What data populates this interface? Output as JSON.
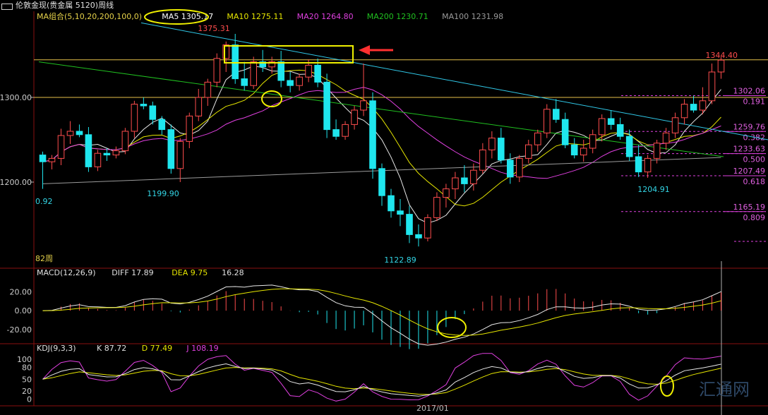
{
  "window": {
    "title": "伦敦金现(贵金属 5120)周线"
  },
  "colors": {
    "up": "#ff4d4d",
    "down": "#1fe6ee",
    "ma5": "#e8e8e8",
    "ma10": "#e6e600",
    "ma20": "#e040e0",
    "ma200": "#20c020",
    "ma100": "#9a9a9a",
    "hline": "#e6c14a",
    "trend": "#30c8e8",
    "annot_yellow": "#f0f000",
    "annot_red": "#ff3030",
    "grid": "#8a1010"
  },
  "price_panel": {
    "legend": [
      {
        "label": "MA组合(5,10,20,200,100,0)",
        "color": "#e6d24a"
      },
      {
        "label": "MA5 1305.17",
        "color": "#ffffff"
      },
      {
        "label": "MA10 1275.11",
        "color": "#e6e600"
      },
      {
        "label": "MA20 1264.80",
        "color": "#e040e0"
      },
      {
        "label": "MA200 1230.71",
        "color": "#20c020"
      },
      {
        "label": "MA100 1231.98",
        "color": "#9a9a9a"
      }
    ],
    "y_ticks": [
      "1300.00",
      "1200.00"
    ],
    "annotations": {
      "high": "1375.31",
      "low1": "1199.90",
      "low2": "1122.89",
      "low3": "1204.91",
      "last": "1344.40",
      "left_small": "0.92",
      "bars_label": "82周"
    },
    "fib_levels": [
      {
        "price": "1302.06",
        "ratio": "0.191"
      },
      {
        "price": "1259.76",
        "ratio": "0.382"
      },
      {
        "price": "1233.63",
        "ratio": "0.500"
      },
      {
        "price": "1207.49",
        "ratio": "0.618"
      },
      {
        "price": "1165.19",
        "ratio": "0.809"
      }
    ]
  },
  "macd_panel": {
    "legend": [
      {
        "label": "MACD(12,26,9)",
        "color": "#e0e0e0"
      },
      {
        "label": "DIFF 17.89",
        "color": "#e0e0e0"
      },
      {
        "label": "DEA 9.75",
        "color": "#e6e600"
      },
      {
        "label": "16.28",
        "color": "#e0e0e0"
      }
    ],
    "y_ticks": [
      "20.00",
      "0.00",
      "-20.00"
    ]
  },
  "kdj_panel": {
    "legend": [
      {
        "label": "KDJ(9,3,3)",
        "color": "#e0e0e0"
      },
      {
        "label": "K 87.72",
        "color": "#e0e0e0"
      },
      {
        "label": "D 77.49",
        "color": "#e6e600"
      },
      {
        "label": "J 108.19",
        "color": "#e040e0"
      }
    ],
    "y_ticks": [
      "100",
      "80",
      "50",
      "20",
      "0"
    ]
  },
  "x_axis": {
    "label": "2017/01"
  },
  "watermark": "汇通网",
  "chart_data": {
    "type": "candlestick",
    "timeframe": "weekly",
    "ylim": [
      1100,
      1390
    ],
    "candles": [
      [
        1232,
        1236,
        1192,
        1224
      ],
      [
        1224,
        1232,
        1215,
        1228
      ],
      [
        1228,
        1263,
        1220,
        1255
      ],
      [
        1255,
        1272,
        1245,
        1260
      ],
      [
        1260,
        1268,
        1253,
        1256
      ],
      [
        1256,
        1265,
        1212,
        1218
      ],
      [
        1218,
        1238,
        1213,
        1234
      ],
      [
        1234,
        1240,
        1225,
        1232
      ],
      [
        1232,
        1242,
        1228,
        1237
      ],
      [
        1237,
        1264,
        1233,
        1260
      ],
      [
        1260,
        1296,
        1252,
        1292
      ],
      [
        1292,
        1300,
        1286,
        1290
      ],
      [
        1290,
        1295,
        1268,
        1274
      ],
      [
        1274,
        1278,
        1256,
        1262
      ],
      [
        1262,
        1268,
        1210,
        1216
      ],
      [
        1216,
        1252,
        1200,
        1248
      ],
      [
        1248,
        1282,
        1240,
        1278
      ],
      [
        1278,
        1310,
        1272,
        1300
      ],
      [
        1300,
        1322,
        1290,
        1318
      ],
      [
        1318,
        1352,
        1312,
        1346
      ],
      [
        1346,
        1366,
        1330,
        1362
      ],
      [
        1362,
        1375,
        1316,
        1322
      ],
      [
        1322,
        1342,
        1308,
        1314
      ],
      [
        1314,
        1348,
        1310,
        1342
      ],
      [
        1342,
        1356,
        1330,
        1336
      ],
      [
        1336,
        1348,
        1328,
        1342
      ],
      [
        1342,
        1355,
        1312,
        1320
      ],
      [
        1320,
        1330,
        1306,
        1314
      ],
      [
        1314,
        1328,
        1308,
        1324
      ],
      [
        1324,
        1345,
        1318,
        1338
      ],
      [
        1338,
        1346,
        1312,
        1318
      ],
      [
        1318,
        1328,
        1252,
        1262
      ],
      [
        1262,
        1274,
        1250,
        1254
      ],
      [
        1254,
        1272,
        1250,
        1268
      ],
      [
        1268,
        1290,
        1262,
        1285
      ],
      [
        1285,
        1340,
        1278,
        1296
      ],
      [
        1296,
        1306,
        1204,
        1216
      ],
      [
        1216,
        1222,
        1172,
        1184
      ],
      [
        1184,
        1192,
        1158,
        1166
      ],
      [
        1166,
        1180,
        1148,
        1162
      ],
      [
        1162,
        1172,
        1128,
        1138
      ],
      [
        1138,
        1150,
        1124,
        1134
      ],
      [
        1134,
        1162,
        1130,
        1158
      ],
      [
        1158,
        1188,
        1154,
        1182
      ],
      [
        1182,
        1198,
        1170,
        1192
      ],
      [
        1192,
        1212,
        1180,
        1205
      ],
      [
        1205,
        1220,
        1188,
        1198
      ],
      [
        1198,
        1222,
        1190,
        1214
      ],
      [
        1214,
        1246,
        1210,
        1238
      ],
      [
        1238,
        1260,
        1228,
        1252
      ],
      [
        1252,
        1264,
        1222,
        1226
      ],
      [
        1226,
        1234,
        1198,
        1206
      ],
      [
        1206,
        1232,
        1200,
        1228
      ],
      [
        1228,
        1250,
        1222,
        1244
      ],
      [
        1244,
        1262,
        1236,
        1258
      ],
      [
        1258,
        1292,
        1252,
        1286
      ],
      [
        1286,
        1298,
        1270,
        1274
      ],
      [
        1274,
        1282,
        1240,
        1244
      ],
      [
        1244,
        1252,
        1228,
        1232
      ],
      [
        1232,
        1250,
        1224,
        1240
      ],
      [
        1240,
        1262,
        1234,
        1256
      ],
      [
        1256,
        1280,
        1248,
        1275
      ],
      [
        1275,
        1285,
        1262,
        1268
      ],
      [
        1268,
        1276,
        1250,
        1254
      ],
      [
        1254,
        1262,
        1225,
        1230
      ],
      [
        1230,
        1244,
        1206,
        1212
      ],
      [
        1212,
        1232,
        1205,
        1228
      ],
      [
        1228,
        1250,
        1222,
        1246
      ],
      [
        1246,
        1264,
        1238,
        1258
      ],
      [
        1258,
        1282,
        1252,
        1276
      ],
      [
        1276,
        1298,
        1268,
        1292
      ],
      [
        1292,
        1302,
        1282,
        1285
      ],
      [
        1285,
        1312,
        1280,
        1296
      ],
      [
        1296,
        1340,
        1292,
        1330
      ],
      [
        1330,
        1348,
        1322,
        1344
      ]
    ],
    "horizontal_lines": [
      1344.4,
      1300
    ],
    "macd_ylim": [
      -32,
      36
    ],
    "kdj_ylim": [
      -8,
      118
    ]
  }
}
